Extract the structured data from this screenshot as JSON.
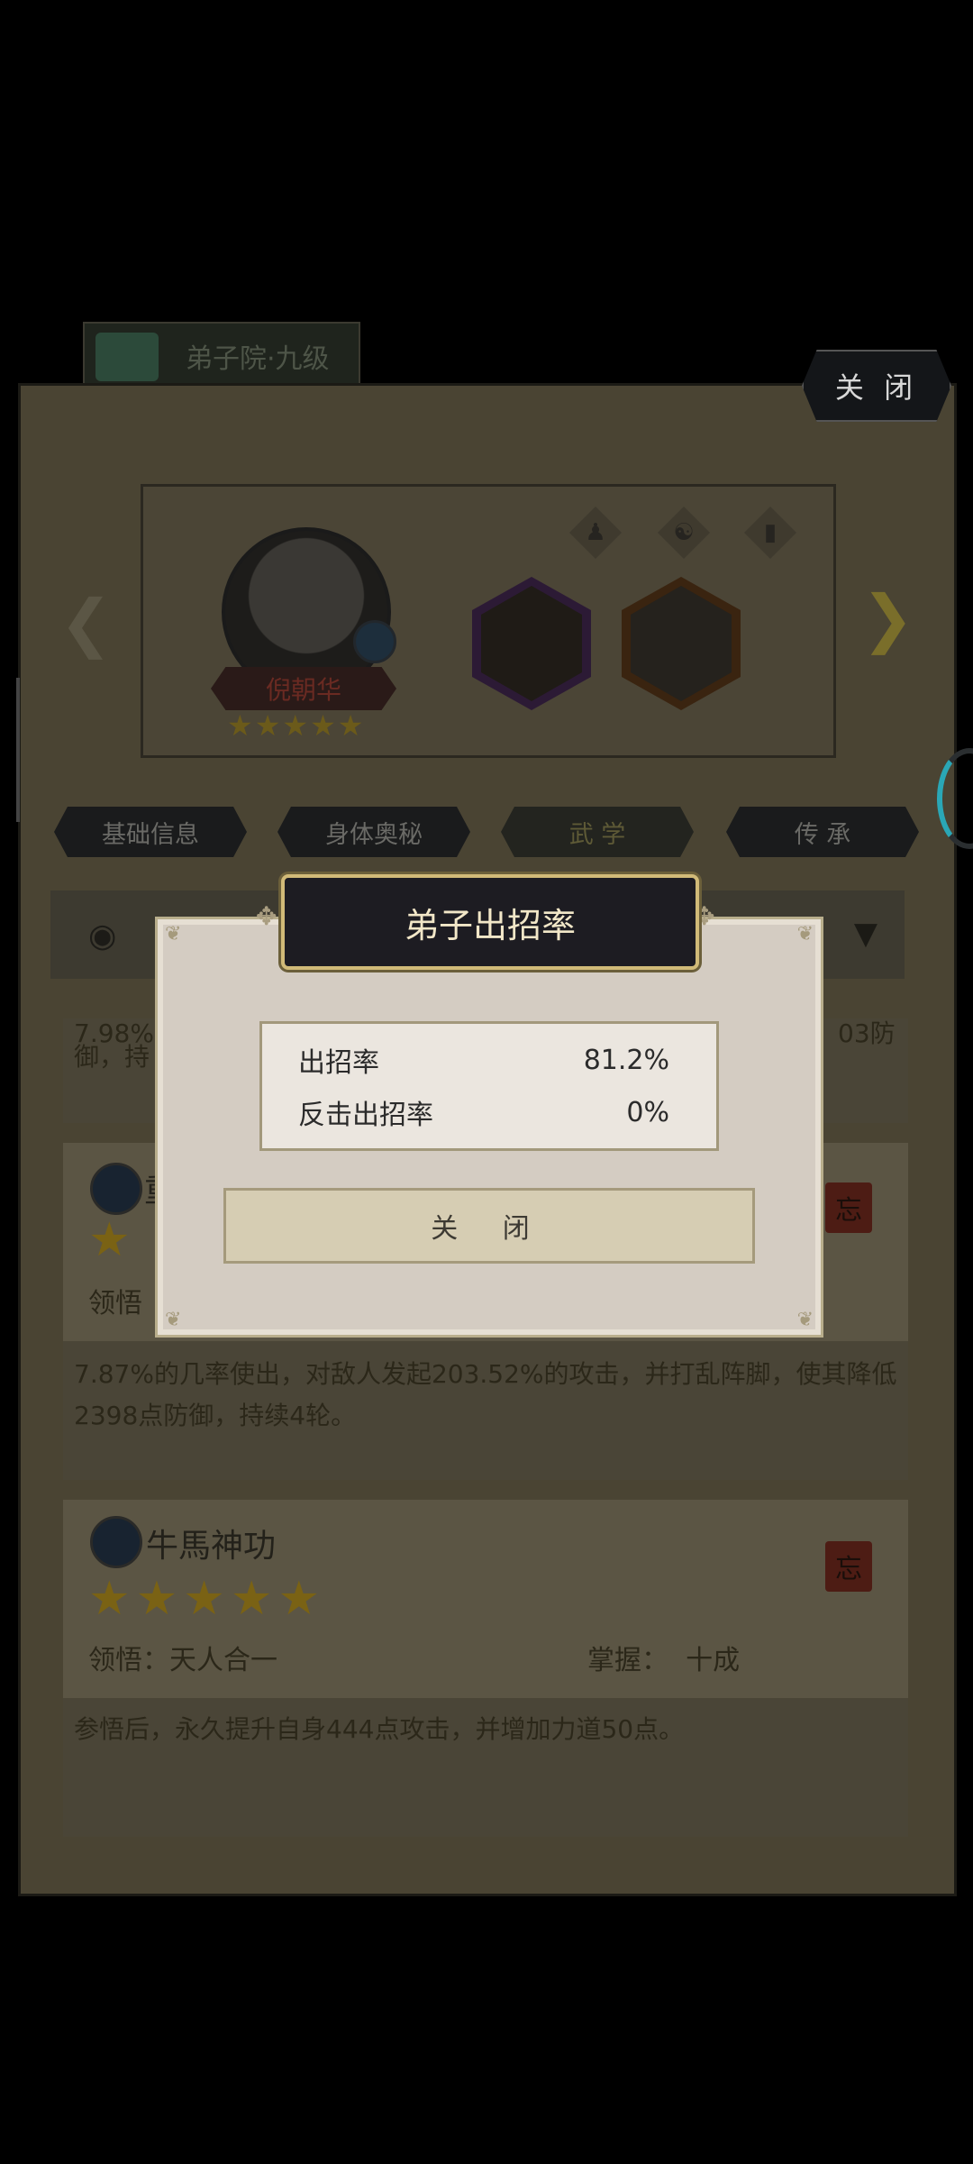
{
  "top": {
    "dorm_label": "弟子院·九级",
    "close_label": "关 闭"
  },
  "hero": {
    "name": "倪朝华",
    "stars": "★★★★★"
  },
  "tabs": [
    {
      "label": "基础信息"
    },
    {
      "label": "身体奥秘"
    },
    {
      "label": "武 学"
    },
    {
      "label": "传 承"
    }
  ],
  "skills": [
    {
      "partial_desc": "御，持",
      "partial_desc_prefix": "7.98%的",
      "partial_desc_suffix": "03防",
      "name_partial": "重",
      "insight_label": "领悟",
      "description": "7.87%的几率使出，对敌人发起203.52%的攻击，并打乱阵脚，使其降低2398点防御，持续4轮。",
      "seal": "忘"
    },
    {
      "name": "牛馬神功",
      "stars": "★★★★★",
      "insight": "领悟：天人合一",
      "mastery": "掌握：  十成",
      "description": "参悟后，永久提升自身444点攻击，并增加力道50点。",
      "seal": "忘"
    }
  ],
  "dialog": {
    "title": "弟子出招率",
    "rows": [
      {
        "label": "出招率",
        "value": "81.2%"
      },
      {
        "label": "反击出招率",
        "value": "0%"
      }
    ],
    "close_label": "关 闭"
  },
  "icons": {
    "eye": "eye-icon",
    "dropdown": "triangle-down-icon",
    "left": "chevron-left-icon",
    "right": "chevron-right-icon"
  }
}
